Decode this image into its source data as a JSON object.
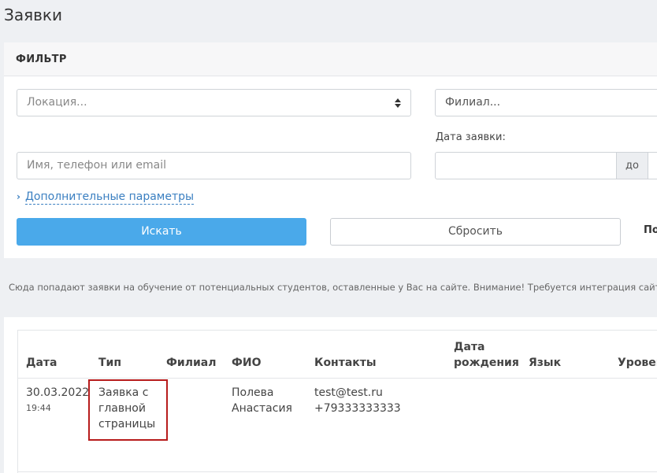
{
  "page": {
    "title": "Заявки"
  },
  "filter": {
    "title": "ФИЛЬТР",
    "location_placeholder": "Локация...",
    "branch_placeholder": "Филиал...",
    "search_placeholder": "Имя, телефон или email",
    "date_label": "Дата заявки:",
    "date_to_label": "до",
    "advanced_link": "Дополнительные параметры",
    "search_button": "Искать",
    "reset_button": "Сбросить",
    "cut_text": "По"
  },
  "info_text": "Сюда попадают заявки на обучение от потенциальных студентов, оставленные у Вас на сайте. Внимание! Требуется интеграция сайта школы",
  "table": {
    "columns": {
      "date": "Дата",
      "type": "Тип",
      "branch": "Филиал",
      "name": "ФИО",
      "contacts": "Контакты",
      "birth_line1": "Дата",
      "birth_line2": "рождения",
      "language": "Язык",
      "level": "Уровень"
    },
    "rows": [
      {
        "date": "30.03.2022",
        "time": "19:44",
        "type_line1": "Заявка с",
        "type_line2": "главной",
        "type_line3": "страницы",
        "branch": "",
        "name_line1": "Полева",
        "name_line2": "Анастасия",
        "email": "test@test.ru",
        "phone": "+79333333333"
      }
    ]
  },
  "colors": {
    "accent": "#4aa9ea",
    "link": "#3a7fc1",
    "highlight_border": "#b71c1c",
    "background": "#eef0f3"
  },
  "icons": [
    "select-arrows-icon",
    "chevron-right-icon"
  ]
}
